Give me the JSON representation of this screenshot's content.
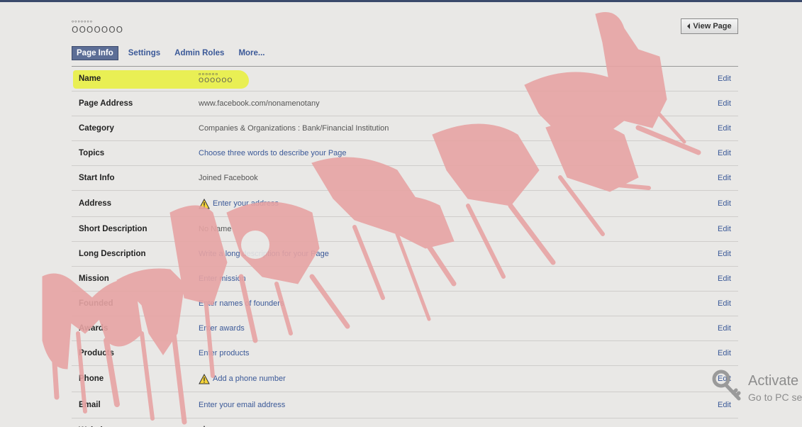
{
  "page": {
    "name": "ᵒᵒᵒᵒᵒᵒᵒ\nOOOOOOO",
    "view_page_label": "View Page"
  },
  "tabs": [
    {
      "label": "Page Info",
      "active": true
    },
    {
      "label": "Settings"
    },
    {
      "label": "Admin Roles"
    },
    {
      "label": "More..."
    }
  ],
  "edit_label": "Edit",
  "rows": [
    {
      "label": "Name",
      "value": "ᵒᵒᵒᵒᵒᵒ\nOOOOOO",
      "style": "gray",
      "warn": false
    },
    {
      "label": "Page Address",
      "value": "www.facebook.com/nonamenotany",
      "style": "gray",
      "warn": false
    },
    {
      "label": "Category",
      "value": "Companies & Organizations : Bank/Financial Institution",
      "style": "gray",
      "warn": false
    },
    {
      "label": "Topics",
      "value": "Choose three words to describe your Page",
      "style": "link",
      "warn": false
    },
    {
      "label": "Start Info",
      "value": "Joined Facebook",
      "style": "gray",
      "warn": false
    },
    {
      "label": "Address",
      "value": "Enter your address",
      "style": "link",
      "warn": true
    },
    {
      "label": "Short Description",
      "value": "No Name",
      "style": "gray",
      "warn": false
    },
    {
      "label": "Long Description",
      "value": "Write a long description for your Page",
      "style": "link",
      "warn": false
    },
    {
      "label": "Mission",
      "value": "Enter mission",
      "style": "link",
      "warn": false
    },
    {
      "label": "Founded",
      "value": "Enter names of founders",
      "style": "link",
      "warn": false
    },
    {
      "label": "Awards",
      "value": "Enter awards",
      "style": "link",
      "warn": false
    },
    {
      "label": "Products",
      "value": "Enter products",
      "style": "link",
      "warn": false
    },
    {
      "label": "Phone",
      "value": "Add a phone number",
      "style": "link",
      "warn": true
    },
    {
      "label": "Email",
      "value": "Enter your email address",
      "style": "link",
      "warn": false
    },
    {
      "label": "Website",
      "value": "",
      "style": "link",
      "warn": true
    }
  ],
  "windows_activation": {
    "title": "Activate",
    "subtitle": "Go to PC se"
  },
  "colors": {
    "link": "#3b5998",
    "active_tab": "#5c6e96",
    "highlight": "#e9f03a",
    "watermark": "#e7a4a4"
  }
}
